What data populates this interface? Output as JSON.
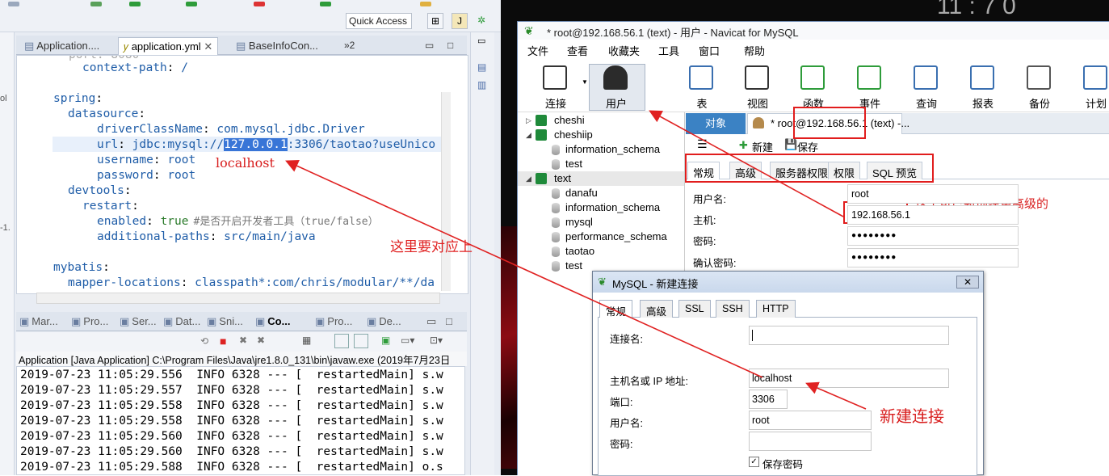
{
  "eclipse": {
    "quick_access": "Quick Access",
    "editor_tabs": [
      "Application....",
      "application.yml",
      "BaseInfoCon...",
      "»2"
    ],
    "editor_lines": [
      {
        "indent": 2,
        "key": "context-path",
        "value": "/"
      },
      {
        "indent": 0,
        "key": "spring",
        "value": ""
      },
      {
        "indent": 1,
        "key": "datasource",
        "value": ""
      },
      {
        "indent": 3,
        "key": "driverClassName",
        "value": "com.mysql.jdbc.Driver"
      },
      {
        "indent": 3,
        "key": "url",
        "value_pre": "jdbc:mysql://",
        "value_sel": "127.0.0.1",
        "value_post": ":3306/taotao?useUnico"
      },
      {
        "indent": 3,
        "key": "username",
        "value": "root"
      },
      {
        "indent": 3,
        "key": "password",
        "value": "root"
      },
      {
        "indent": 1,
        "key": "devtools",
        "value": ""
      },
      {
        "indent": 2,
        "key": "restart",
        "value": ""
      },
      {
        "indent": 3,
        "key": "enabled",
        "value": "true",
        "comment": "#是否开启开发者工具（true/false）"
      },
      {
        "indent": 3,
        "key": "additional-paths",
        "value": "src/main/java"
      },
      {
        "indent": 0,
        "key": "mybatis",
        "value": ""
      },
      {
        "indent": 1,
        "key": "mapper-locations",
        "value": "classpath*:com/chris/modular/**/da"
      }
    ],
    "annotation_localhost": "localhost",
    "annotation_left": "这里要对应上",
    "console_tabs": [
      "Mar...",
      "Pro...",
      "Ser...",
      "Dat...",
      "Sni...",
      "Co...",
      "Pro...",
      "De..."
    ],
    "console_header": "Application [Java Application] C:\\Program Files\\Java\\jre1.8.0_131\\bin\\javaw.exe (2019年7月23日",
    "log_lines": [
      "2019-07-23 11:05:29.556  INFO 6328 --- [  restartedMain] s.w",
      "2019-07-23 11:05:29.557  INFO 6328 --- [  restartedMain] s.w",
      "2019-07-23 11:05:29.558  INFO 6328 --- [  restartedMain] s.w",
      "2019-07-23 11:05:29.558  INFO 6328 --- [  restartedMain] s.w",
      "2019-07-23 11:05:29.560  INFO 6328 --- [  restartedMain] s.w",
      "2019-07-23 11:05:29.560  INFO 6328 --- [  restartedMain] s.w",
      "2019-07-23 11:05:29.588  INFO 6328 --- [  restartedMain] o.s"
    ],
    "left_strip_labels": [
      "ol",
      "-1."
    ]
  },
  "navicat": {
    "title": "* root@192.168.56.1 (text) - 用户 - Navicat for MySQL",
    "menu": [
      "文件",
      "查看",
      "收藏夹",
      "工具",
      "窗口",
      "帮助"
    ],
    "toolbar": [
      "连接",
      "用户",
      "表",
      "视图",
      "函数",
      "事件",
      "查询",
      "报表",
      "备份",
      "计划"
    ],
    "tree": [
      {
        "label": "cheshi",
        "level": 0,
        "type": "conn",
        "expanded": false
      },
      {
        "label": "cheshiip",
        "level": 0,
        "type": "conn",
        "expanded": true
      },
      {
        "label": "information_schema",
        "level": 1,
        "type": "db"
      },
      {
        "label": "test",
        "level": 1,
        "type": "db"
      },
      {
        "label": "text",
        "level": 0,
        "type": "conn",
        "expanded": true,
        "selected": true
      },
      {
        "label": "danafu",
        "level": 1,
        "type": "db"
      },
      {
        "label": "information_schema",
        "level": 1,
        "type": "db"
      },
      {
        "label": "mysql",
        "level": 1,
        "type": "db"
      },
      {
        "label": "performance_schema",
        "level": 1,
        "type": "db"
      },
      {
        "label": "taotao",
        "level": 1,
        "type": "db"
      },
      {
        "label": "test",
        "level": 1,
        "type": "db"
      }
    ],
    "tab_objects": "对象",
    "tab_root": "* root@192.168.56.1 (text) -...",
    "new_label": "新建",
    "save_label": "保存",
    "prop_tabs": [
      "常规",
      "高级",
      "服务器权限",
      "权限",
      "SQL 预览"
    ],
    "form": [
      {
        "label": "用户名:",
        "value": "root"
      },
      {
        "label": "主机:",
        "value": "192.168.56.1"
      },
      {
        "label": "密码:",
        "value": "●●●●●●●●"
      },
      {
        "label": "确认密码:",
        "value": "●●●●●●●●"
      }
    ],
    "annotation_right": "这里可已新创建更高级的"
  },
  "dialog": {
    "title": "MySQL - 新建连接",
    "close": "✕",
    "tabs": [
      "常规",
      "高级",
      "SSL",
      "SSH",
      "HTTP"
    ],
    "conn_name_label": "连接名:",
    "conn_name_value": "",
    "host_label": "主机名或 IP 地址:",
    "host_value": "localhost",
    "port_label": "端口:",
    "port_value": "3306",
    "user_label": "用户名:",
    "user_value": "root",
    "password_label": "密码:",
    "password_value": "",
    "save_password": "保存密码"
  },
  "annotation_new_connection": "新建连接",
  "phone_glyphs": "11 : 7 0"
}
